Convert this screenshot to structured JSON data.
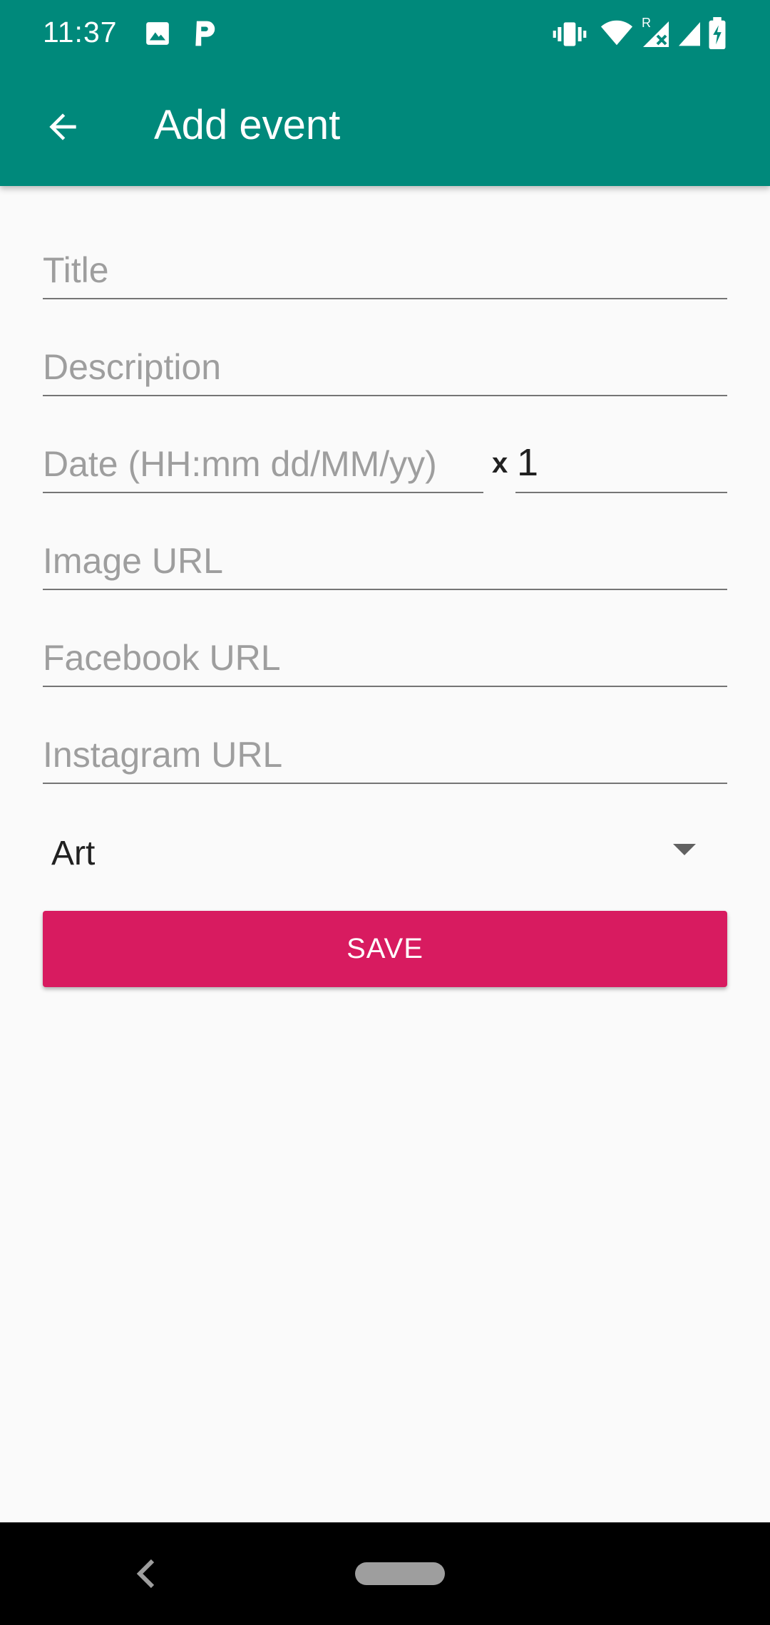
{
  "status_bar": {
    "time": "11:37",
    "left_icons": [
      "image-icon",
      "parking-icon"
    ],
    "right_icons": [
      "vibrate-icon",
      "wifi-icon",
      "signal-roaming-icon",
      "signal-icon",
      "battery-charging-icon"
    ],
    "roaming_mark": "R"
  },
  "toolbar": {
    "title": "Add event",
    "back_icon": "arrow-back-icon",
    "background": "#00897b"
  },
  "form": {
    "title_placeholder": "Title",
    "description_placeholder": "Description",
    "date_placeholder": "Date (HH:mm dd/MM/yy)",
    "multiplier_label": "x",
    "count_value": "1",
    "image_url_placeholder": "Image URL",
    "facebook_url_placeholder": "Facebook URL",
    "instagram_url_placeholder": "Instagram URL",
    "category_selected": "Art",
    "save_label": "SAVE",
    "save_color": "#d81b60"
  },
  "nav_bar": {
    "back_icon": "nav-back-icon",
    "home_icon": "home-pill-icon"
  }
}
